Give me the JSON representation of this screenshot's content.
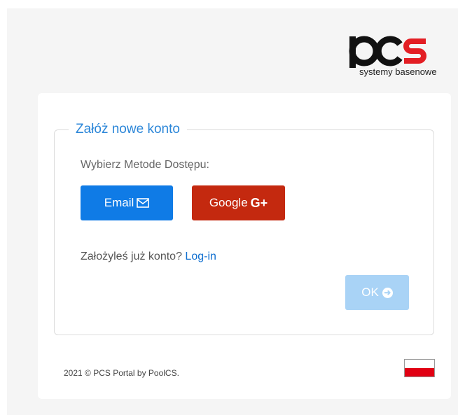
{
  "brand": {
    "logo_text": "pcs",
    "tagline": "systemy basenowe",
    "colors": {
      "dark": "#111111",
      "accent": "#e31e24"
    }
  },
  "form": {
    "legend": "Załóż nowe konto",
    "method_label": "Wybierz Metode Dostępu:",
    "email_button": "Email",
    "email_icon": "envelope-icon",
    "google_button": "Google",
    "google_icon": "google-plus-icon",
    "google_glyph": "G+",
    "login_prompt": "Założyleś już konto?",
    "login_link": "Log-in",
    "ok_button": "OK",
    "ok_icon": "arrow-circle-right-icon",
    "colors": {
      "email": "#0f7be6",
      "google": "#c4290f",
      "ok_disabled": "#a9d3f6",
      "legend": "#2b86d8"
    }
  },
  "footer": {
    "copyright": "2021 © PCS Portal by PoolCS.",
    "language_flag": "poland-flag-icon"
  }
}
